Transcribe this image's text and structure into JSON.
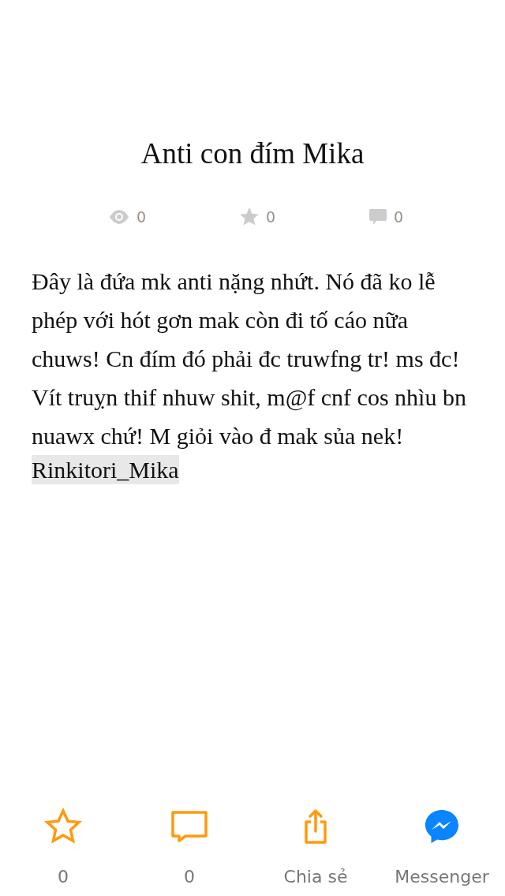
{
  "title": "Anti con đím Mika",
  "stats": [
    {
      "kind": "views",
      "count": "0"
    },
    {
      "kind": "stars",
      "count": "0"
    },
    {
      "kind": "comments",
      "count": "0"
    }
  ],
  "body": "Đây là đứa mk anti nặng nhứt. Nó đã ko lễ phép với hót gơn mak còn đi tố cáo nữa chuws! Cn đím đó phải đc truwfng tr! ms đc! Vít truỵn thif nhuw shit, m@f cnf cos nhìu bn nuawx chứ! M giỏi vào đ mak sủa nek!",
  "mention": "Rinkitori_Mika",
  "actions": [
    {
      "kind": "star",
      "label": "0"
    },
    {
      "kind": "comment",
      "label": "0"
    },
    {
      "kind": "share",
      "label": "Chia sẻ"
    },
    {
      "kind": "messenger",
      "label": "Messenger"
    }
  ]
}
